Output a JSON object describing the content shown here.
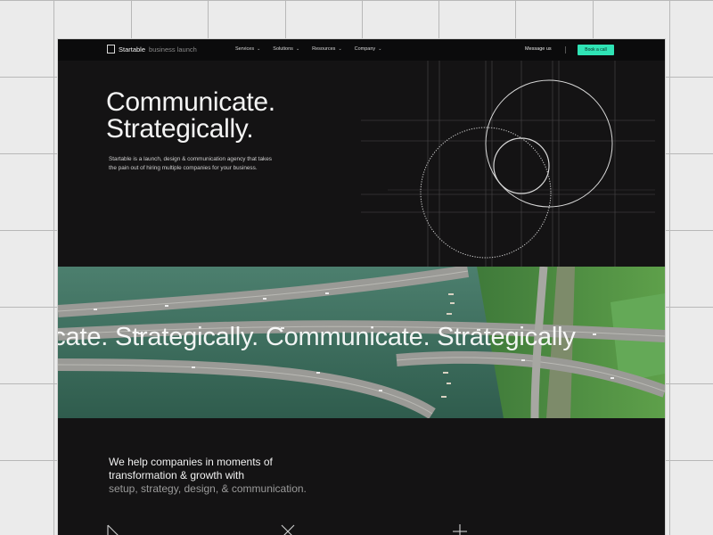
{
  "nav": {
    "brand_name": "Startable",
    "brand_tagline": "business launch",
    "links": [
      {
        "label": "Services"
      },
      {
        "label": "Solutions"
      },
      {
        "label": "Resources"
      },
      {
        "label": "Company"
      }
    ],
    "message_label": "Message us",
    "cta_label": "Book a call"
  },
  "hero": {
    "title_line1": "Communicate.",
    "title_line2": "Strategically.",
    "description": "Startable is a launch, design & communication agency that takes the pain out of hiring multiple companies for your business."
  },
  "band": {
    "marquee_text": "icate. Strategically. Communicate. Strategically"
  },
  "intro": {
    "line1": "We help companies in moments of",
    "line2": "transformation & growth with",
    "line3": "setup, strategy, design, & communication."
  },
  "icons": [
    "arrow-down-right-icon",
    "close-icon",
    "plus-icon"
  ],
  "colors": {
    "accent": "#2fe3b5",
    "page_background": "#141314",
    "nav_background": "#0b0b0c",
    "text_primary": "#f4f4f4",
    "text_muted": "#9a9a9a"
  }
}
